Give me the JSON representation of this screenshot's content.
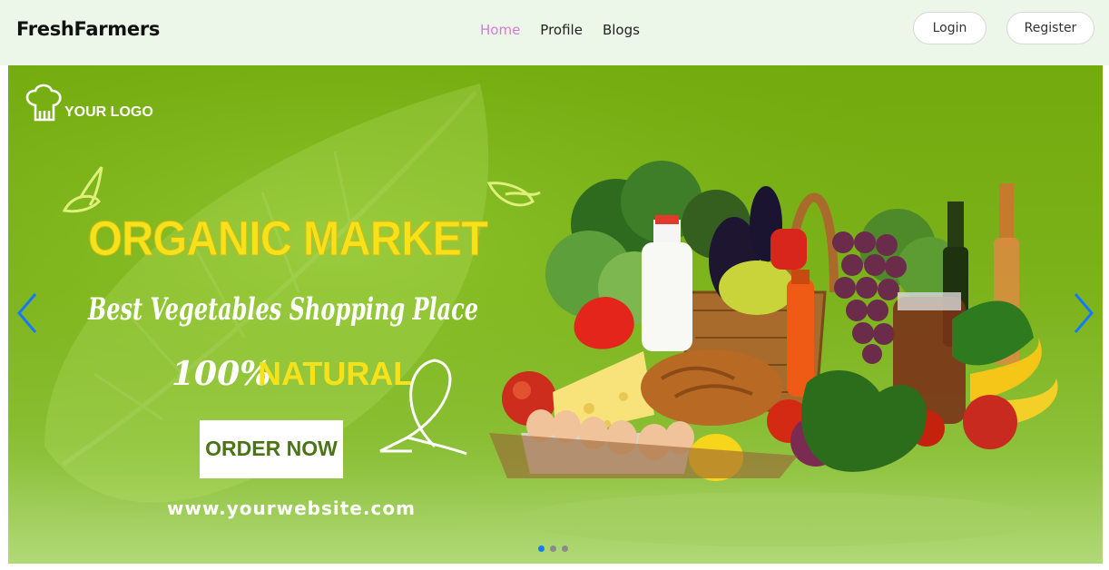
{
  "navbar": {
    "brand": "FreshFarmers",
    "links": [
      {
        "label": "Home",
        "active": true
      },
      {
        "label": "Profile",
        "active": false
      },
      {
        "label": "Blogs",
        "active": false
      }
    ],
    "login_label": "Login",
    "register_label": "Register"
  },
  "banner": {
    "logo_text": "YOUR LOGO",
    "headline": "ORGANIC MARKET",
    "tagline": "Best Vegetables Shopping Place",
    "natural_prefix": "100%",
    "natural_word": "NATURAL",
    "cta": "ORDER NOW",
    "website": "www.yourwebsite.com"
  },
  "carousel": {
    "slide_count": 3,
    "active_index": 0
  },
  "colors": {
    "nav_bg": "#edf7e9",
    "active_link": "#d978d9",
    "banner_green": "#73ab0e",
    "headline_yellow": "#f6e21b",
    "indicator_active": "#1677ff",
    "arrow_blue": "#1677ff"
  }
}
